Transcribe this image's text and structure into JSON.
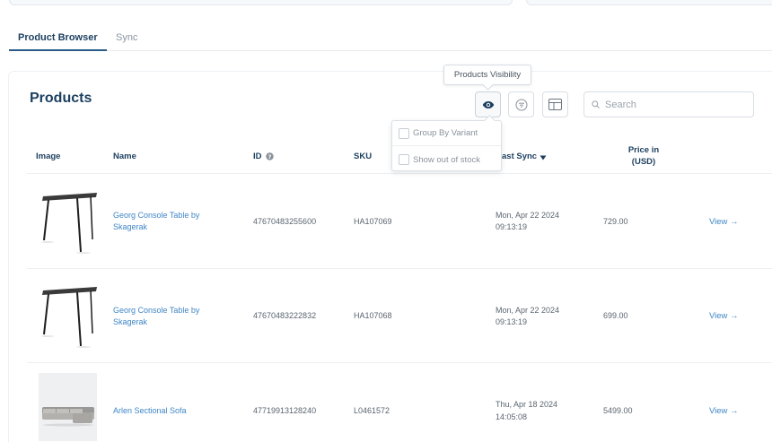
{
  "tabs": [
    {
      "label": "Product Browser",
      "active": true
    },
    {
      "label": "Sync",
      "active": false
    }
  ],
  "panel": {
    "title": "Products"
  },
  "toolbar": {
    "tooltip": "Products Visibility",
    "search_placeholder": "Search",
    "visibility_menu": [
      {
        "label": "Group By Variant",
        "checked": false
      },
      {
        "label": "Show out of stock",
        "checked": false
      }
    ]
  },
  "table": {
    "headers": {
      "image": "Image",
      "name": "Name",
      "id": "ID",
      "sku": "SKU",
      "last_sync": "ast Sync",
      "price_line1": "Price in",
      "price_line2": "(USD)"
    },
    "rows": [
      {
        "name": "Georg Console Table by Skagerak",
        "id": "47670483255600",
        "sku": "HA107069",
        "sync_date": "Mon, Apr 22 2024",
        "sync_time": "09:13:19",
        "price": "729.00",
        "action": "View",
        "image": "console-table"
      },
      {
        "name": "Georg Console Table by Skagerak",
        "id": "47670483222832",
        "sku": "HA107068",
        "sync_date": "Mon, Apr 22 2024",
        "sync_time": "09:13:19",
        "price": "699.00",
        "action": "View",
        "image": "console-table"
      },
      {
        "name": "Arlen Sectional Sofa",
        "id": "47719913128240",
        "sku": "L0461572",
        "sync_date": "Thu, Apr 18 2024",
        "sync_time": "14:05:08",
        "price": "5499.00",
        "action": "View",
        "image": "sectional-sofa"
      }
    ]
  },
  "colors": {
    "accent": "#1c3f5f",
    "link": "#3f86c6",
    "border": "#e6eaee"
  }
}
